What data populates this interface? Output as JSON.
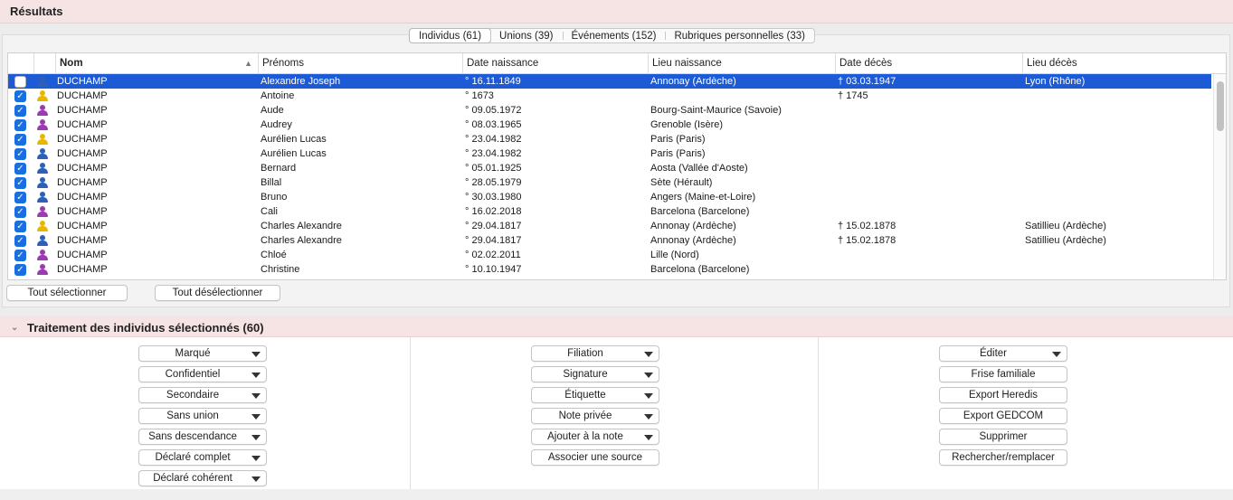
{
  "results": {
    "title": "Résultats",
    "tabs": [
      {
        "label": "Individus (61)",
        "active": true
      },
      {
        "label": "Unions (39)",
        "active": false
      },
      {
        "label": "Événements (152)",
        "active": false
      },
      {
        "label": "Rubriques personnelles (33)",
        "active": false
      }
    ],
    "columns": {
      "nom": "Nom",
      "prenoms": "Prénoms",
      "date_naissance": "Date naissance",
      "lieu_naissance": "Lieu naissance",
      "date_deces": "Date décès",
      "lieu_deces": "Lieu décès"
    },
    "sort_icon": "sort-ascending-icon",
    "rows": [
      {
        "checked": false,
        "selected": true,
        "gender": "male",
        "nom": "DUCHAMP",
        "prenoms": "Alexandre Joseph",
        "date_naissance": "° 16.11.1849",
        "lieu_naissance": "Annonay (Ardèche)",
        "date_deces": "† 03.03.1947",
        "lieu_deces": "Lyon (Rhône)"
      },
      {
        "checked": true,
        "selected": false,
        "gender": "unknown",
        "nom": "DUCHAMP",
        "prenoms": "Antoine",
        "date_naissance": "° 1673",
        "lieu_naissance": "",
        "date_deces": "† 1745",
        "lieu_deces": ""
      },
      {
        "checked": true,
        "selected": false,
        "gender": "female",
        "nom": "DUCHAMP",
        "prenoms": "Aude",
        "date_naissance": "° 09.05.1972",
        "lieu_naissance": "Bourg-Saint-Maurice (Savoie)",
        "date_deces": "",
        "lieu_deces": ""
      },
      {
        "checked": true,
        "selected": false,
        "gender": "female",
        "nom": "DUCHAMP",
        "prenoms": "Audrey",
        "date_naissance": "° 08.03.1965",
        "lieu_naissance": "Grenoble (Isère)",
        "date_deces": "",
        "lieu_deces": ""
      },
      {
        "checked": true,
        "selected": false,
        "gender": "unknown",
        "nom": "DUCHAMP",
        "prenoms": "Aurélien Lucas",
        "date_naissance": "° 23.04.1982",
        "lieu_naissance": "Paris (Paris)",
        "date_deces": "",
        "lieu_deces": ""
      },
      {
        "checked": true,
        "selected": false,
        "gender": "male",
        "nom": "DUCHAMP",
        "prenoms": "Aurélien Lucas",
        "date_naissance": "° 23.04.1982",
        "lieu_naissance": "Paris (Paris)",
        "date_deces": "",
        "lieu_deces": ""
      },
      {
        "checked": true,
        "selected": false,
        "gender": "male",
        "nom": "DUCHAMP",
        "prenoms": "Bernard",
        "date_naissance": "° 05.01.1925",
        "lieu_naissance": "Aosta (Vallée d'Aoste)",
        "date_deces": "",
        "lieu_deces": ""
      },
      {
        "checked": true,
        "selected": false,
        "gender": "male",
        "nom": "DUCHAMP",
        "prenoms": "Billal",
        "date_naissance": "° 28.05.1979",
        "lieu_naissance": "Sète (Hérault)",
        "date_deces": "",
        "lieu_deces": ""
      },
      {
        "checked": true,
        "selected": false,
        "gender": "male",
        "nom": "DUCHAMP",
        "prenoms": "Bruno",
        "date_naissance": "° 30.03.1980",
        "lieu_naissance": "Angers (Maine-et-Loire)",
        "date_deces": "",
        "lieu_deces": ""
      },
      {
        "checked": true,
        "selected": false,
        "gender": "female",
        "nom": "DUCHAMP",
        "prenoms": "Cali",
        "date_naissance": "° 16.02.2018",
        "lieu_naissance": "Barcelona (Barcelone)",
        "date_deces": "",
        "lieu_deces": ""
      },
      {
        "checked": true,
        "selected": false,
        "gender": "unknown",
        "nom": "DUCHAMP",
        "prenoms": "Charles Alexandre",
        "date_naissance": "° 29.04.1817",
        "lieu_naissance": "Annonay (Ardèche)",
        "date_deces": "† 15.02.1878",
        "lieu_deces": "Satillieu (Ardèche)"
      },
      {
        "checked": true,
        "selected": false,
        "gender": "male",
        "nom": "DUCHAMP",
        "prenoms": "Charles Alexandre",
        "date_naissance": "° 29.04.1817",
        "lieu_naissance": "Annonay (Ardèche)",
        "date_deces": "† 15.02.1878",
        "lieu_deces": "Satillieu (Ardèche)"
      },
      {
        "checked": true,
        "selected": false,
        "gender": "female",
        "nom": "DUCHAMP",
        "prenoms": "Chloé",
        "date_naissance": "° 02.02.2011",
        "lieu_naissance": "Lille (Nord)",
        "date_deces": "",
        "lieu_deces": ""
      },
      {
        "checked": true,
        "selected": false,
        "gender": "female",
        "nom": "DUCHAMP",
        "prenoms": "Christine",
        "date_naissance": "° 10.10.1947",
        "lieu_naissance": "Barcelona (Barcelone)",
        "date_deces": "",
        "lieu_deces": ""
      }
    ],
    "select_all": "Tout sélectionner",
    "deselect_all": "Tout désélectionner"
  },
  "treatment": {
    "title": "Traitement des individus sélectionnés (60)",
    "col1": [
      {
        "label": "Marqué",
        "dropdown": true
      },
      {
        "label": "Confidentiel",
        "dropdown": true
      },
      {
        "label": "Secondaire",
        "dropdown": true
      },
      {
        "label": "Sans union",
        "dropdown": true
      },
      {
        "label": "Sans descendance",
        "dropdown": true
      },
      {
        "label": "Déclaré complet",
        "dropdown": true
      },
      {
        "label": "Déclaré cohérent",
        "dropdown": true
      }
    ],
    "col2": [
      {
        "label": "Filiation",
        "dropdown": true
      },
      {
        "label": "Signature",
        "dropdown": true
      },
      {
        "label": "Étiquette",
        "dropdown": true
      },
      {
        "label": "Note privée",
        "dropdown": true
      },
      {
        "label": "Ajouter à la note",
        "dropdown": true
      },
      {
        "label": "Associer une source",
        "dropdown": false
      }
    ],
    "col3": [
      {
        "label": "Éditer",
        "dropdown": true
      },
      {
        "label": "Frise familiale",
        "dropdown": false
      },
      {
        "label": "Export Heredis",
        "dropdown": false
      },
      {
        "label": "Export GEDCOM",
        "dropdown": false
      },
      {
        "label": "Supprimer",
        "dropdown": false
      },
      {
        "label": "Rechercher/remplacer",
        "dropdown": false
      }
    ]
  },
  "colors": {
    "selection": "#1d5bd6",
    "male": "#2d5fb8",
    "female": "#9a3bb0",
    "unknown": "#e8b800",
    "header_band": "#f6e3e3"
  }
}
